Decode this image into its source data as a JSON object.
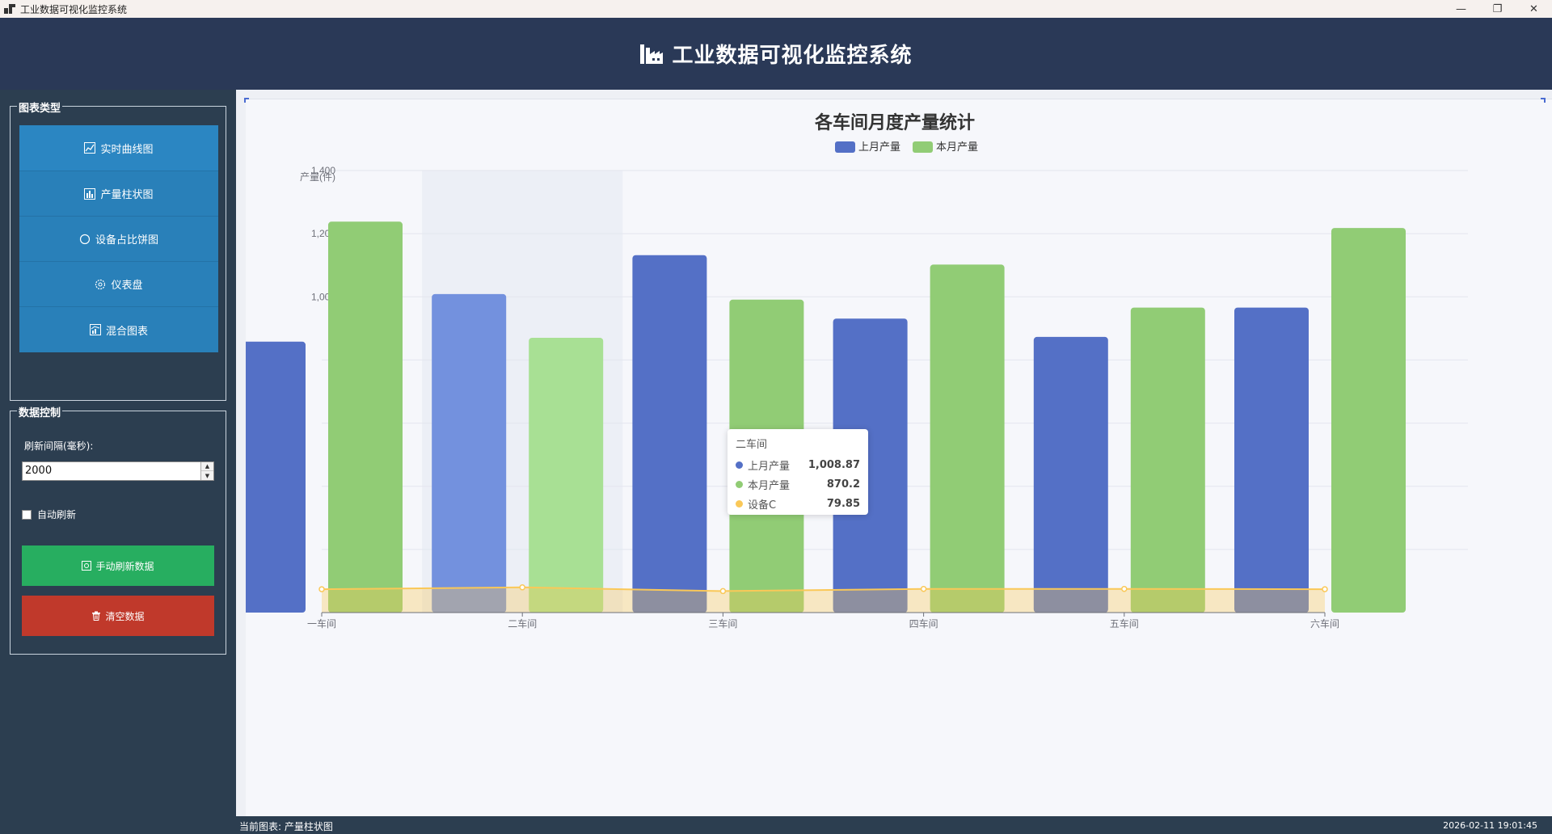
{
  "window": {
    "title": "工业数据可视化监控系统",
    "minimize": "—",
    "restore": "❐",
    "close": "✕"
  },
  "header": {
    "title": "工业数据可视化监控系统",
    "icon": "factory-icon"
  },
  "sidebar": {
    "chart_types_title": "图表类型",
    "chart_buttons": [
      {
        "label": "实时曲线图",
        "icon": "line-chart-icon"
      },
      {
        "label": "产量柱状图",
        "icon": "bar-chart-icon"
      },
      {
        "label": "设备占比饼图",
        "icon": "pie-chart-icon"
      },
      {
        "label": "仪表盘",
        "icon": "gauge-icon"
      },
      {
        "label": "混合图表",
        "icon": "mixed-chart-icon"
      }
    ],
    "data_control_title": "数据控制",
    "refresh_interval_label": "刷新间隔(毫秒):",
    "refresh_interval_value": "2000",
    "auto_refresh_label": "自动刷新",
    "auto_refresh_checked": false,
    "manual_refresh_label": "手动刷新数据",
    "clear_label": "清空数据"
  },
  "chart_data": {
    "type": "bar",
    "title": "各车间月度产量统计",
    "ylabel": "产量(件)",
    "xlabel": "",
    "ylim": [
      0,
      1400
    ],
    "yticks": [
      "1,400",
      "1,200",
      "1,000"
    ],
    "categories": [
      "一车间",
      "二车间",
      "三车间",
      "四车间",
      "五车间",
      "六车间"
    ],
    "series": [
      {
        "name": "上月产量",
        "color": "#5470c6",
        "values": [
          858,
          1008.87,
          1132,
          931,
          873,
          966
        ]
      },
      {
        "name": "本月产量",
        "color": "#91cc75",
        "values": [
          1238,
          870.2,
          991,
          1102,
          966,
          1218
        ]
      },
      {
        "name": "设备C",
        "color": "#fac858",
        "type": "area",
        "values": [
          74,
          79.85,
          68,
          75,
          75,
          74
        ]
      }
    ],
    "legend": [
      "上月产量",
      "本月产量"
    ],
    "legend_position": "top",
    "grid": true,
    "highlight_category": "二车间"
  },
  "tooltip": {
    "title": "二车间",
    "rows": [
      {
        "name": "上月产量",
        "value": "1,008.87",
        "color": "#5470c6"
      },
      {
        "name": "本月产量",
        "value": "870.2",
        "color": "#91cc75"
      },
      {
        "name": "设备C",
        "value": "79.85",
        "color": "#fac858"
      }
    ]
  },
  "status": {
    "current_chart": "当前图表: 产量柱状图",
    "timestamp": "2026-02-11 19:01:45"
  }
}
